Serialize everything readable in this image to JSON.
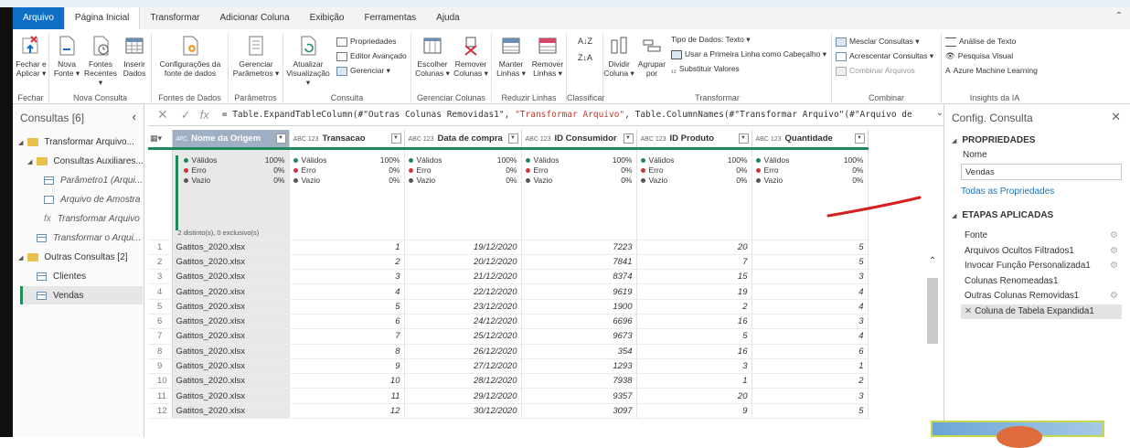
{
  "tabs": [
    "Arquivo",
    "Página Inicial",
    "Transformar",
    "Adicionar Coluna",
    "Exibição",
    "Ferramentas",
    "Ajuda"
  ],
  "ribbon": {
    "fechar": {
      "label1": "Fechar e",
      "label2": "Aplicar ▾",
      "group": "Fechar"
    },
    "nova_consulta": {
      "nova1": "Nova",
      "nova2": "Fonte ▾",
      "fontes1": "Fontes",
      "fontes2": "Recentes ▾",
      "inserir1": "Inserir",
      "inserir2": "Dados",
      "group": "Nova Consulta"
    },
    "fontes": {
      "config1": "Configurações da",
      "config2": "fonte de dados",
      "group": "Fontes de Dados"
    },
    "parametros": {
      "ger1": "Gerenciar",
      "ger2": "Parâmetros ▾",
      "group": "Parâmetros"
    },
    "consulta": {
      "atu1": "Atualizar",
      "atu2": "Visualização ▾",
      "propriedades": "Propriedades",
      "editor": "Editor Avançado",
      "gerenciar": "Gerenciar ▾",
      "group": "Consulta"
    },
    "colunas": {
      "esc1": "Escolher",
      "esc2": "Colunas ▾",
      "rem1": "Remover",
      "rem2": "Colunas ▾",
      "group": "Gerenciar Colunas"
    },
    "linhas": {
      "man1": "Manter",
      "man2": "Linhas ▾",
      "rem1": "Remover",
      "rem2": "Linhas ▾",
      "group": "Reduzir Linhas"
    },
    "classificar": {
      "group": "Classificar"
    },
    "transformar": {
      "div1": "Dividir",
      "div2": "Coluna ▾",
      "agr1": "Agrupar",
      "agr2": "por",
      "tipo": "Tipo de Dados: Texto ▾",
      "primeira": "Usar a Primeira Linha como Cabeçalho ▾",
      "substituir": "Substituir Valores",
      "group": "Transformar"
    },
    "combinar": {
      "mesclar": "Mesclar Consultas ▾",
      "acrescentar": "Acrescentar Consultas ▾",
      "arquivos": "Combinar Arquivos",
      "group": "Combinar"
    },
    "ia": {
      "texto": "Análise de Texto",
      "visual": "Pesquisa Visual",
      "azure": "Azure Machine Learning",
      "group": "Insights da IA"
    }
  },
  "queries": {
    "header": "Consultas [6]",
    "items": [
      {
        "label": "Transformar Arquivo...",
        "kind": "folder"
      },
      {
        "label": "Consultas Auxiliares...",
        "kind": "folder"
      },
      {
        "label": "Parâmetro1 (Arqui...",
        "kind": "param"
      },
      {
        "label": "Arquivo de Amostra",
        "kind": "file"
      },
      {
        "label": "Transformar Arquivo",
        "kind": "fx"
      },
      {
        "label": "Transformar o Arqui...",
        "kind": "table"
      },
      {
        "label": "Outras Consultas [2]",
        "kind": "folder"
      },
      {
        "label": "Clientes",
        "kind": "table"
      },
      {
        "label": "Vendas",
        "kind": "table"
      }
    ]
  },
  "formula": {
    "fx": "fx",
    "p1": "= Table.ExpandTableColumn(#\"Outras Colunas Removidas1\", ",
    "p2": "\"Transformar Arquivo\"",
    "p3": ", Table.ColumnNames(#\"Transformar Arquivo\"(#\"Arquivo de"
  },
  "columns": [
    {
      "type": "AᴮC",
      "name": "Nome da Origem"
    },
    {
      "type": "ABC 123",
      "name": "Transacao"
    },
    {
      "type": "ABC 123",
      "name": "Data de compra"
    },
    {
      "type": "ABC 123",
      "name": "ID Consumidor"
    },
    {
      "type": "ABC 123",
      "name": "ID Produto"
    },
    {
      "type": "ABC 123",
      "name": "Quantidade"
    }
  ],
  "quality": {
    "valid_label": "Válidos",
    "error_label": "Erro",
    "empty_label": "Vazio",
    "valid_pct": "100%",
    "error_pct": "0%",
    "empty_pct": "0%",
    "distinct": "2 distinto(s), 0 exclusivo(s)",
    "colors": {
      "valid": "#1d8a5b",
      "error": "#d13438",
      "empty": "#555555"
    }
  },
  "rows": [
    [
      "1",
      "Gatitos_2020.xlsx",
      "1",
      "19/12/2020",
      "7223",
      "20",
      "5"
    ],
    [
      "2",
      "Gatitos_2020.xlsx",
      "2",
      "20/12/2020",
      "7841",
      "7",
      "5"
    ],
    [
      "3",
      "Gatitos_2020.xlsx",
      "3",
      "21/12/2020",
      "8374",
      "15",
      "3"
    ],
    [
      "4",
      "Gatitos_2020.xlsx",
      "4",
      "22/12/2020",
      "9619",
      "19",
      "4"
    ],
    [
      "5",
      "Gatitos_2020.xlsx",
      "5",
      "23/12/2020",
      "1900",
      "2",
      "4"
    ],
    [
      "6",
      "Gatitos_2020.xlsx",
      "6",
      "24/12/2020",
      "6696",
      "16",
      "3"
    ],
    [
      "7",
      "Gatitos_2020.xlsx",
      "7",
      "25/12/2020",
      "9673",
      "5",
      "4"
    ],
    [
      "8",
      "Gatitos_2020.xlsx",
      "8",
      "26/12/2020",
      "354",
      "16",
      "6"
    ],
    [
      "9",
      "Gatitos_2020.xlsx",
      "9",
      "27/12/2020",
      "1293",
      "3",
      "1"
    ],
    [
      "10",
      "Gatitos_2020.xlsx",
      "10",
      "28/12/2020",
      "7938",
      "1",
      "2"
    ],
    [
      "11",
      "Gatitos_2020.xlsx",
      "11",
      "29/12/2020",
      "9357",
      "20",
      "3"
    ],
    [
      "12",
      "Gatitos_2020.xlsx",
      "12",
      "30/12/2020",
      "3097",
      "9",
      "5"
    ]
  ],
  "settings": {
    "header": "Config. Consulta",
    "props_title": "PROPRIEDADES",
    "name_label": "Nome",
    "name_value": "Vendas",
    "all_props": "Todas as Propriedades",
    "steps_title": "ETAPAS APLICADAS",
    "steps": [
      {
        "label": "Fonte",
        "gear": true
      },
      {
        "label": "Arquivos Ocultos Filtrados1",
        "gear": true
      },
      {
        "label": "Invocar Função Personalizada1",
        "gear": true
      },
      {
        "label": "Colunas Renomeadas1",
        "gear": false
      },
      {
        "label": "Outras Colunas Removidas1",
        "gear": true
      },
      {
        "label": "Coluna de Tabela Expandida1",
        "gear": false
      }
    ]
  },
  "accent": {
    "file_tab": "#0f6fc6",
    "quality_bar": "#1d8a5b",
    "annotation": "#d62020"
  }
}
